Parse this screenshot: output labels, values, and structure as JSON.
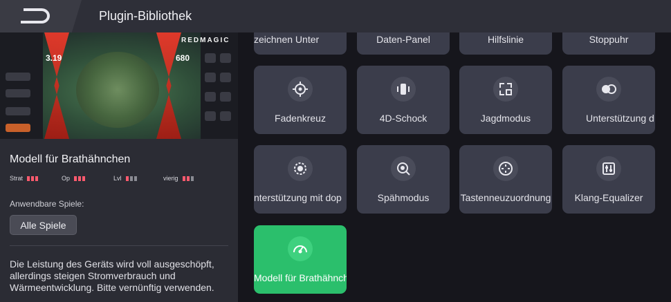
{
  "header": {
    "title": "Plugin-Bibliothek",
    "back_icon": "brand-back-icon"
  },
  "preview": {
    "brand": "REDMAGIC",
    "stat_left": "3.19",
    "stat_right": "680"
  },
  "model": {
    "title": "Modell für Brathähnchen",
    "stats": [
      {
        "label": "Strat",
        "level": 3
      },
      {
        "label": "Op",
        "level": 3
      },
      {
        "label": "Lvl",
        "level": 1
      },
      {
        "label": "vierig",
        "level": 2
      }
    ],
    "games_label": "Anwendbare Spiele:",
    "games_button": "Alle Spiele",
    "description": "Die Leistung des Geräts wird voll ausgeschöpft, allerdings steigen Stromverbrauch und Wärmeentwicklung. Bitte vernünftig verwenden."
  },
  "plugins": {
    "top_row": [
      "zeichnen         Unter",
      "Daten-Panel",
      "Hilfslinie",
      "Stoppuhr"
    ],
    "row1": [
      {
        "label": "Fadenkreuz",
        "icon": "crosshair-icon"
      },
      {
        "label": "4D-Schock",
        "icon": "vibration-icon"
      },
      {
        "label": "Jagdmodus",
        "icon": "hunt-mode-icon"
      },
      {
        "label": "Unterstützung d",
        "icon": "dual-circle-icon"
      }
    ],
    "row2": [
      {
        "label": "nterstützung mit dop",
        "icon": "double-ring-icon"
      },
      {
        "label": "Spähmodus",
        "icon": "scout-icon"
      },
      {
        "label": "Tastenneuzuordnung",
        "icon": "key-remap-icon"
      },
      {
        "label": "Klang-Equalizer",
        "icon": "equalizer-icon"
      }
    ],
    "row3": [
      {
        "label": "Modell für Brathähnche",
        "icon": "speedometer-icon",
        "active": true
      }
    ]
  },
  "colors": {
    "active_tile": "#2bbf6c",
    "tile": "#3b3d4b",
    "stat_bar": "#ff5a6e"
  }
}
